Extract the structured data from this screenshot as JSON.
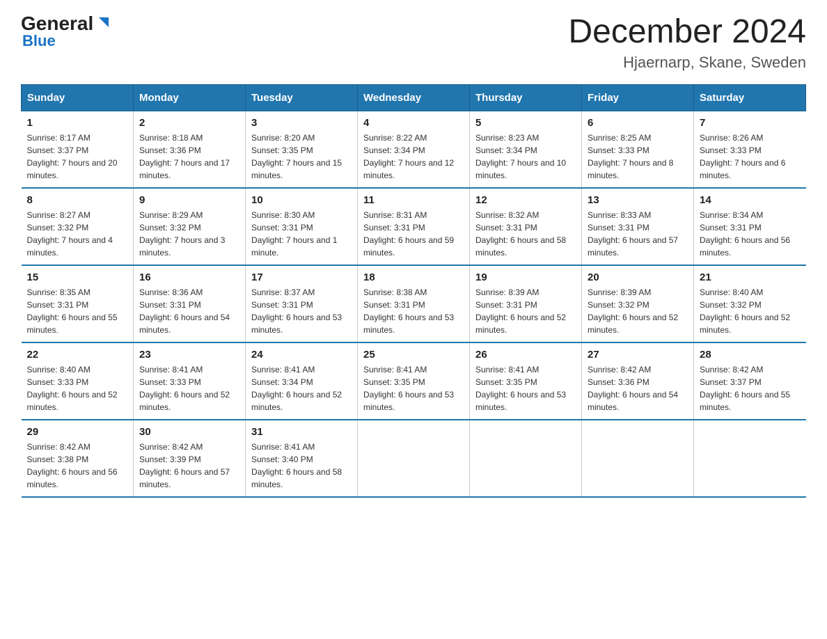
{
  "logo": {
    "general": "General",
    "blue": "Blue",
    "arrow": "▶"
  },
  "header": {
    "month_year": "December 2024",
    "location": "Hjaernarp, Skane, Sweden"
  },
  "days_of_week": [
    "Sunday",
    "Monday",
    "Tuesday",
    "Wednesday",
    "Thursday",
    "Friday",
    "Saturday"
  ],
  "weeks": [
    [
      {
        "day": "1",
        "sunrise": "8:17 AM",
        "sunset": "3:37 PM",
        "daylight": "7 hours and 20 minutes."
      },
      {
        "day": "2",
        "sunrise": "8:18 AM",
        "sunset": "3:36 PM",
        "daylight": "7 hours and 17 minutes."
      },
      {
        "day": "3",
        "sunrise": "8:20 AM",
        "sunset": "3:35 PM",
        "daylight": "7 hours and 15 minutes."
      },
      {
        "day": "4",
        "sunrise": "8:22 AM",
        "sunset": "3:34 PM",
        "daylight": "7 hours and 12 minutes."
      },
      {
        "day": "5",
        "sunrise": "8:23 AM",
        "sunset": "3:34 PM",
        "daylight": "7 hours and 10 minutes."
      },
      {
        "day": "6",
        "sunrise": "8:25 AM",
        "sunset": "3:33 PM",
        "daylight": "7 hours and 8 minutes."
      },
      {
        "day": "7",
        "sunrise": "8:26 AM",
        "sunset": "3:33 PM",
        "daylight": "7 hours and 6 minutes."
      }
    ],
    [
      {
        "day": "8",
        "sunrise": "8:27 AM",
        "sunset": "3:32 PM",
        "daylight": "7 hours and 4 minutes."
      },
      {
        "day": "9",
        "sunrise": "8:29 AM",
        "sunset": "3:32 PM",
        "daylight": "7 hours and 3 minutes."
      },
      {
        "day": "10",
        "sunrise": "8:30 AM",
        "sunset": "3:31 PM",
        "daylight": "7 hours and 1 minute."
      },
      {
        "day": "11",
        "sunrise": "8:31 AM",
        "sunset": "3:31 PM",
        "daylight": "6 hours and 59 minutes."
      },
      {
        "day": "12",
        "sunrise": "8:32 AM",
        "sunset": "3:31 PM",
        "daylight": "6 hours and 58 minutes."
      },
      {
        "day": "13",
        "sunrise": "8:33 AM",
        "sunset": "3:31 PM",
        "daylight": "6 hours and 57 minutes."
      },
      {
        "day": "14",
        "sunrise": "8:34 AM",
        "sunset": "3:31 PM",
        "daylight": "6 hours and 56 minutes."
      }
    ],
    [
      {
        "day": "15",
        "sunrise": "8:35 AM",
        "sunset": "3:31 PM",
        "daylight": "6 hours and 55 minutes."
      },
      {
        "day": "16",
        "sunrise": "8:36 AM",
        "sunset": "3:31 PM",
        "daylight": "6 hours and 54 minutes."
      },
      {
        "day": "17",
        "sunrise": "8:37 AM",
        "sunset": "3:31 PM",
        "daylight": "6 hours and 53 minutes."
      },
      {
        "day": "18",
        "sunrise": "8:38 AM",
        "sunset": "3:31 PM",
        "daylight": "6 hours and 53 minutes."
      },
      {
        "day": "19",
        "sunrise": "8:39 AM",
        "sunset": "3:31 PM",
        "daylight": "6 hours and 52 minutes."
      },
      {
        "day": "20",
        "sunrise": "8:39 AM",
        "sunset": "3:32 PM",
        "daylight": "6 hours and 52 minutes."
      },
      {
        "day": "21",
        "sunrise": "8:40 AM",
        "sunset": "3:32 PM",
        "daylight": "6 hours and 52 minutes."
      }
    ],
    [
      {
        "day": "22",
        "sunrise": "8:40 AM",
        "sunset": "3:33 PM",
        "daylight": "6 hours and 52 minutes."
      },
      {
        "day": "23",
        "sunrise": "8:41 AM",
        "sunset": "3:33 PM",
        "daylight": "6 hours and 52 minutes."
      },
      {
        "day": "24",
        "sunrise": "8:41 AM",
        "sunset": "3:34 PM",
        "daylight": "6 hours and 52 minutes."
      },
      {
        "day": "25",
        "sunrise": "8:41 AM",
        "sunset": "3:35 PM",
        "daylight": "6 hours and 53 minutes."
      },
      {
        "day": "26",
        "sunrise": "8:41 AM",
        "sunset": "3:35 PM",
        "daylight": "6 hours and 53 minutes."
      },
      {
        "day": "27",
        "sunrise": "8:42 AM",
        "sunset": "3:36 PM",
        "daylight": "6 hours and 54 minutes."
      },
      {
        "day": "28",
        "sunrise": "8:42 AM",
        "sunset": "3:37 PM",
        "daylight": "6 hours and 55 minutes."
      }
    ],
    [
      {
        "day": "29",
        "sunrise": "8:42 AM",
        "sunset": "3:38 PM",
        "daylight": "6 hours and 56 minutes."
      },
      {
        "day": "30",
        "sunrise": "8:42 AM",
        "sunset": "3:39 PM",
        "daylight": "6 hours and 57 minutes."
      },
      {
        "day": "31",
        "sunrise": "8:41 AM",
        "sunset": "3:40 PM",
        "daylight": "6 hours and 58 minutes."
      },
      null,
      null,
      null,
      null
    ]
  ]
}
